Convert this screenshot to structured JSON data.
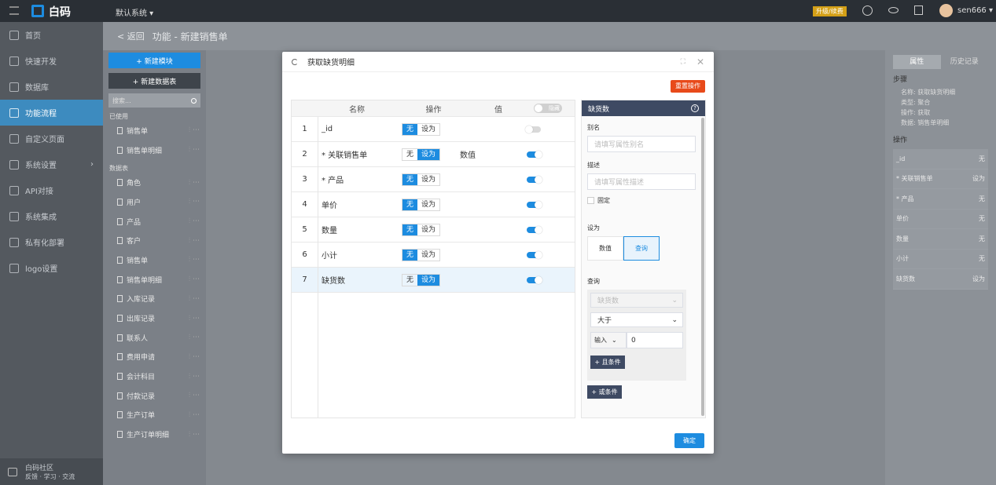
{
  "app": {
    "brand": "白码",
    "system": "默认系统 ▾",
    "upgrade": "升级/续费",
    "user": "sen666 ▾"
  },
  "sidebar": [
    {
      "label": "首页"
    },
    {
      "label": "快速开发"
    },
    {
      "label": "数据库"
    },
    {
      "label": "功能流程",
      "active": true
    },
    {
      "label": "自定义页面"
    },
    {
      "label": "系统设置"
    },
    {
      "label": "API对接"
    },
    {
      "label": "系统集成"
    },
    {
      "label": "私有化部署"
    },
    {
      "label": "logo设置"
    }
  ],
  "community": {
    "title": "白码社区",
    "sub": "反馈 · 学习 · 交流"
  },
  "breadcrumb": {
    "back": "< 返回",
    "title": "功能 - 新建销售单"
  },
  "panel2": {
    "new_module": "+ 新建模块",
    "new_table": "+ 新建数据表",
    "search_placeholder": "搜索...",
    "used_label": "已使用",
    "used": [
      "销售单",
      "销售单明细"
    ],
    "tables_label": "数据表",
    "tables": [
      "角色",
      "用户",
      "产品",
      "客户",
      "销售单",
      "销售单明细",
      "入库记录",
      "出库记录",
      "联系人",
      "费用申请",
      "会计科目",
      "付款记录",
      "生产订单",
      "生产订单明细"
    ]
  },
  "right": {
    "tabs": [
      "属性",
      "历史记录"
    ],
    "step_label": "步骤",
    "step_info": [
      "名称: 获取缺货明细",
      "类型: 聚合",
      "操作: 获取",
      "数据: 销售单明细"
    ],
    "ops_label": "操作",
    "ops": [
      {
        "name": "_id",
        "val": "无"
      },
      {
        "name": "* 关联销售单",
        "val": "设为"
      },
      {
        "name": "* 产品",
        "val": "无"
      },
      {
        "name": "单价",
        "val": "无"
      },
      {
        "name": "数量",
        "val": "无"
      },
      {
        "name": "小计",
        "val": "无"
      },
      {
        "name": "缺货数",
        "val": "设为"
      }
    ]
  },
  "modal": {
    "title": "获取缺货明细",
    "reset": "重置操作",
    "confirm": "确定",
    "cols": {
      "name": "名称",
      "op": "操作",
      "val": "值",
      "toggle": "隐藏"
    },
    "seg_none": "无",
    "seg_set": "设为",
    "rows": [
      {
        "idx": "1",
        "name": "_id",
        "sel": "none",
        "val": "",
        "on": false
      },
      {
        "idx": "2",
        "name": "* 关联销售单",
        "sel": "set",
        "val": "数值",
        "on": true
      },
      {
        "idx": "3",
        "name": "* 产品",
        "sel": "none",
        "val": "",
        "on": true
      },
      {
        "idx": "4",
        "name": "单价",
        "sel": "none",
        "val": "",
        "on": true
      },
      {
        "idx": "5",
        "name": "数量",
        "sel": "none",
        "val": "",
        "on": true
      },
      {
        "idx": "6",
        "name": "小计",
        "sel": "none",
        "val": "",
        "on": true
      },
      {
        "idx": "7",
        "name": "缺货数",
        "sel": "set",
        "val": "",
        "on": true
      }
    ],
    "detail": {
      "title": "缺货数",
      "alias_label": "别名",
      "alias_placeholder": "请填写属性别名",
      "desc_label": "描述",
      "desc_placeholder": "请填写属性描述",
      "fixed_label": "固定",
      "setas_label": "设为",
      "setas_opts": [
        "数值",
        "查询"
      ],
      "query_label": "查询",
      "query_field": "缺货数",
      "query_op": "大于",
      "query_input_type": "输入",
      "query_value": "0",
      "and_btn": "+ 且条件",
      "or_btn": "+ 或条件"
    }
  }
}
